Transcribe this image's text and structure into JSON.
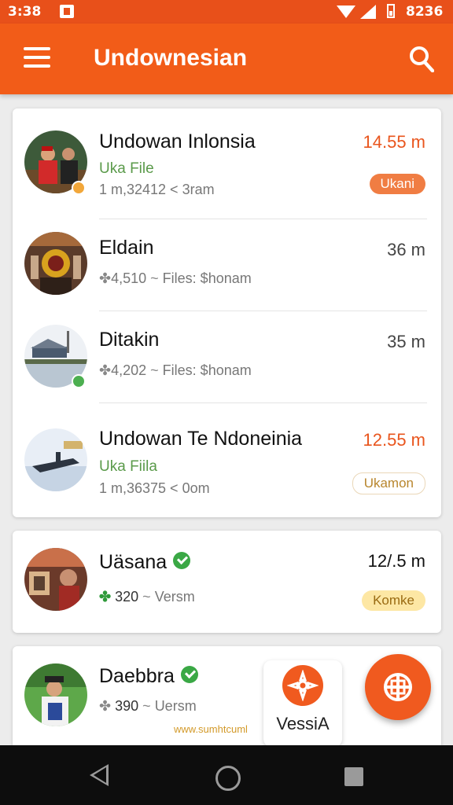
{
  "status_bar": {
    "time": "3:38",
    "clock": "8236"
  },
  "app_bar": {
    "title": "Undownesian"
  },
  "items": [
    {
      "title": "Undowan Inlonsia",
      "sub": "Uka File",
      "meta": "1 m,32412 < 3ram",
      "size": "14.55 m",
      "pill": "Ukani"
    },
    {
      "title": "Eldain",
      "meta_count": "4,510",
      "meta_rest": "Files: $honam",
      "size": "36 m"
    },
    {
      "title": "Ditakin",
      "meta_count": "4,202",
      "meta_rest": "Files: $honam",
      "size": "35 m"
    },
    {
      "title": "Undowan Te Ndoneinia",
      "sub": "Uka Fiila",
      "meta": "1 m,36375 < 0om",
      "size": "12.55 m",
      "pill": "Ukamon"
    },
    {
      "title": "Uäsana",
      "meta_count": "320",
      "meta_rest": "Versm",
      "size": "12/.5 m",
      "pill": "Komke"
    },
    {
      "title": "Daebbra",
      "meta_count": "390",
      "meta_rest": "Uersm",
      "overflow": "www.sumhtcuml"
    }
  ],
  "floating": {
    "chip_label": "VessiA"
  },
  "icons": {
    "menu": "menu-icon",
    "search": "search-icon",
    "fab": "grid-icon",
    "chip": "flower-icon",
    "verified": "check-icon",
    "back": "back-icon",
    "home": "home-icon",
    "recents": "recents-icon"
  },
  "colors": {
    "primary": "#f25c18",
    "accent": "#e9551d",
    "verified": "#3aa845"
  }
}
